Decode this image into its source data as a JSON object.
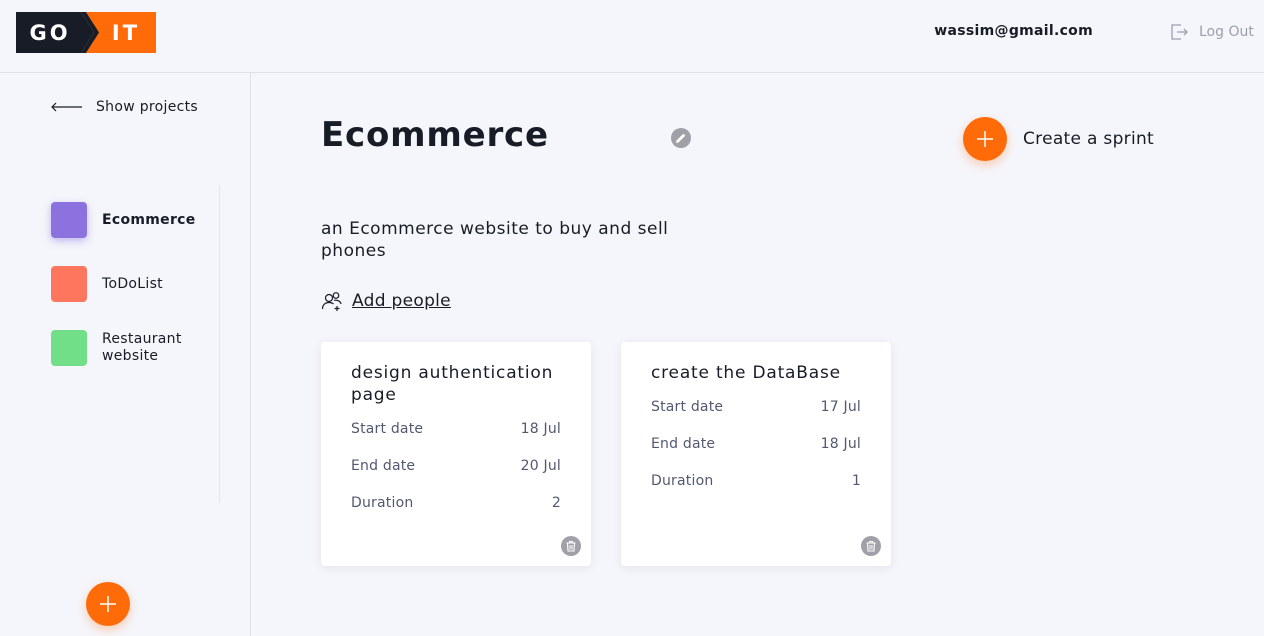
{
  "header": {
    "logo_left": "GO",
    "logo_right": "IT",
    "user_email": "wassim@gmail.com",
    "logout_label": "Log Out"
  },
  "sidebar": {
    "back_label": "Show projects",
    "projects": [
      {
        "label": "Ecommerce",
        "color": "#8c72df",
        "active": true
      },
      {
        "label": "ToDoList",
        "color": "#ff765f",
        "active": false
      },
      {
        "label": "Restaurant website",
        "color": "#71df87",
        "active": false
      }
    ]
  },
  "main": {
    "title": "Ecommerce",
    "description": "an Ecommerce website to buy and sell phones",
    "create_sprint_label": "Create a sprint",
    "add_people_label": "Add people",
    "sprints": [
      {
        "title": "design authentication page",
        "rows": [
          {
            "label": "Start date",
            "value": "18 Jul"
          },
          {
            "label": "End date",
            "value": "20 Jul"
          },
          {
            "label": "Duration",
            "value": "2"
          }
        ]
      },
      {
        "title": "create the DataBase",
        "rows": [
          {
            "label": "Start date",
            "value": "17 Jul"
          },
          {
            "label": "End date",
            "value": "18 Jul"
          },
          {
            "label": "Duration",
            "value": "1"
          }
        ]
      }
    ]
  },
  "colors": {
    "accent": "#ff6b08",
    "logo_dark": "#181c27",
    "background": "#f5f6fb"
  },
  "icons": {
    "back": "arrow-left-icon",
    "logout": "logout-icon",
    "edit": "pencil-icon",
    "add": "plus-icon",
    "add_people": "add-user-icon",
    "delete": "trash-icon"
  }
}
